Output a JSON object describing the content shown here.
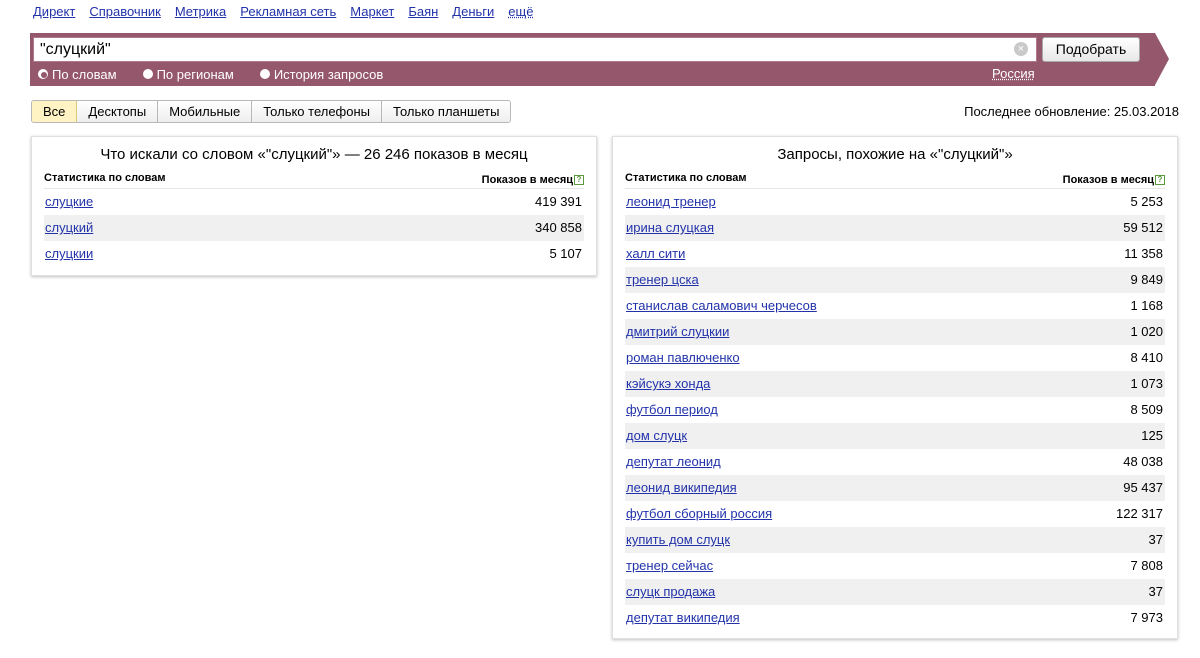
{
  "nav": [
    "Директ",
    "Справочник",
    "Метрика",
    "Рекламная сеть",
    "Маркет",
    "Баян",
    "Деньги",
    "ещё"
  ],
  "search": {
    "value": "\"слуцкий\"",
    "button": "Подобрать",
    "region": "Россия",
    "modes": [
      {
        "label": "По словам",
        "selected": true
      },
      {
        "label": "По регионам",
        "selected": false
      },
      {
        "label": "История запросов",
        "selected": false
      }
    ]
  },
  "tabs": [
    {
      "label": "Все",
      "active": true
    },
    {
      "label": "Десктопы",
      "active": false
    },
    {
      "label": "Мобильные",
      "active": false
    },
    {
      "label": "Только телефоны",
      "active": false
    },
    {
      "label": "Только планшеты",
      "active": false
    }
  ],
  "updated": "Последнее обновление: 25.03.2018",
  "left": {
    "title": "Что искали со словом «\"слуцкий\"» — 26 246 показов в месяц",
    "col_phrase": "Статистика по словам",
    "col_count": "Показов в месяц",
    "rows": [
      {
        "phrase": "слуцкие",
        "count": "419 391"
      },
      {
        "phrase": "слуцкий",
        "count": "340 858"
      },
      {
        "phrase": "слуцкии",
        "count": "5 107"
      }
    ]
  },
  "right": {
    "title": "Запросы, похожие на «\"слуцкий\"»",
    "col_phrase": "Статистика по словам",
    "col_count": "Показов в месяц",
    "rows": [
      {
        "phrase": "леонид тренер",
        "count": "5 253"
      },
      {
        "phrase": "ирина слуцкая",
        "count": "59 512"
      },
      {
        "phrase": "халл сити",
        "count": "11 358"
      },
      {
        "phrase": "тренер цска",
        "count": "9 849"
      },
      {
        "phrase": "станислав саламович черчесов",
        "count": "1 168"
      },
      {
        "phrase": "дмитрий слуцкии",
        "count": "1 020"
      },
      {
        "phrase": "роман павлюченко",
        "count": "8 410"
      },
      {
        "phrase": "кэйсукэ хонда",
        "count": "1 073"
      },
      {
        "phrase": "футбол период",
        "count": "8 509"
      },
      {
        "phrase": "дом слуцк",
        "count": "125"
      },
      {
        "phrase": "депутат леонид",
        "count": "48 038"
      },
      {
        "phrase": "леонид википедия",
        "count": "95 437"
      },
      {
        "phrase": "футбол сборный россия",
        "count": "122 317"
      },
      {
        "phrase": "купить дом слуцк",
        "count": "37"
      },
      {
        "phrase": "тренер сейчас",
        "count": "7 808"
      },
      {
        "phrase": "слуцк продажа",
        "count": "37"
      },
      {
        "phrase": "депутат википедия",
        "count": "7 973"
      }
    ]
  }
}
